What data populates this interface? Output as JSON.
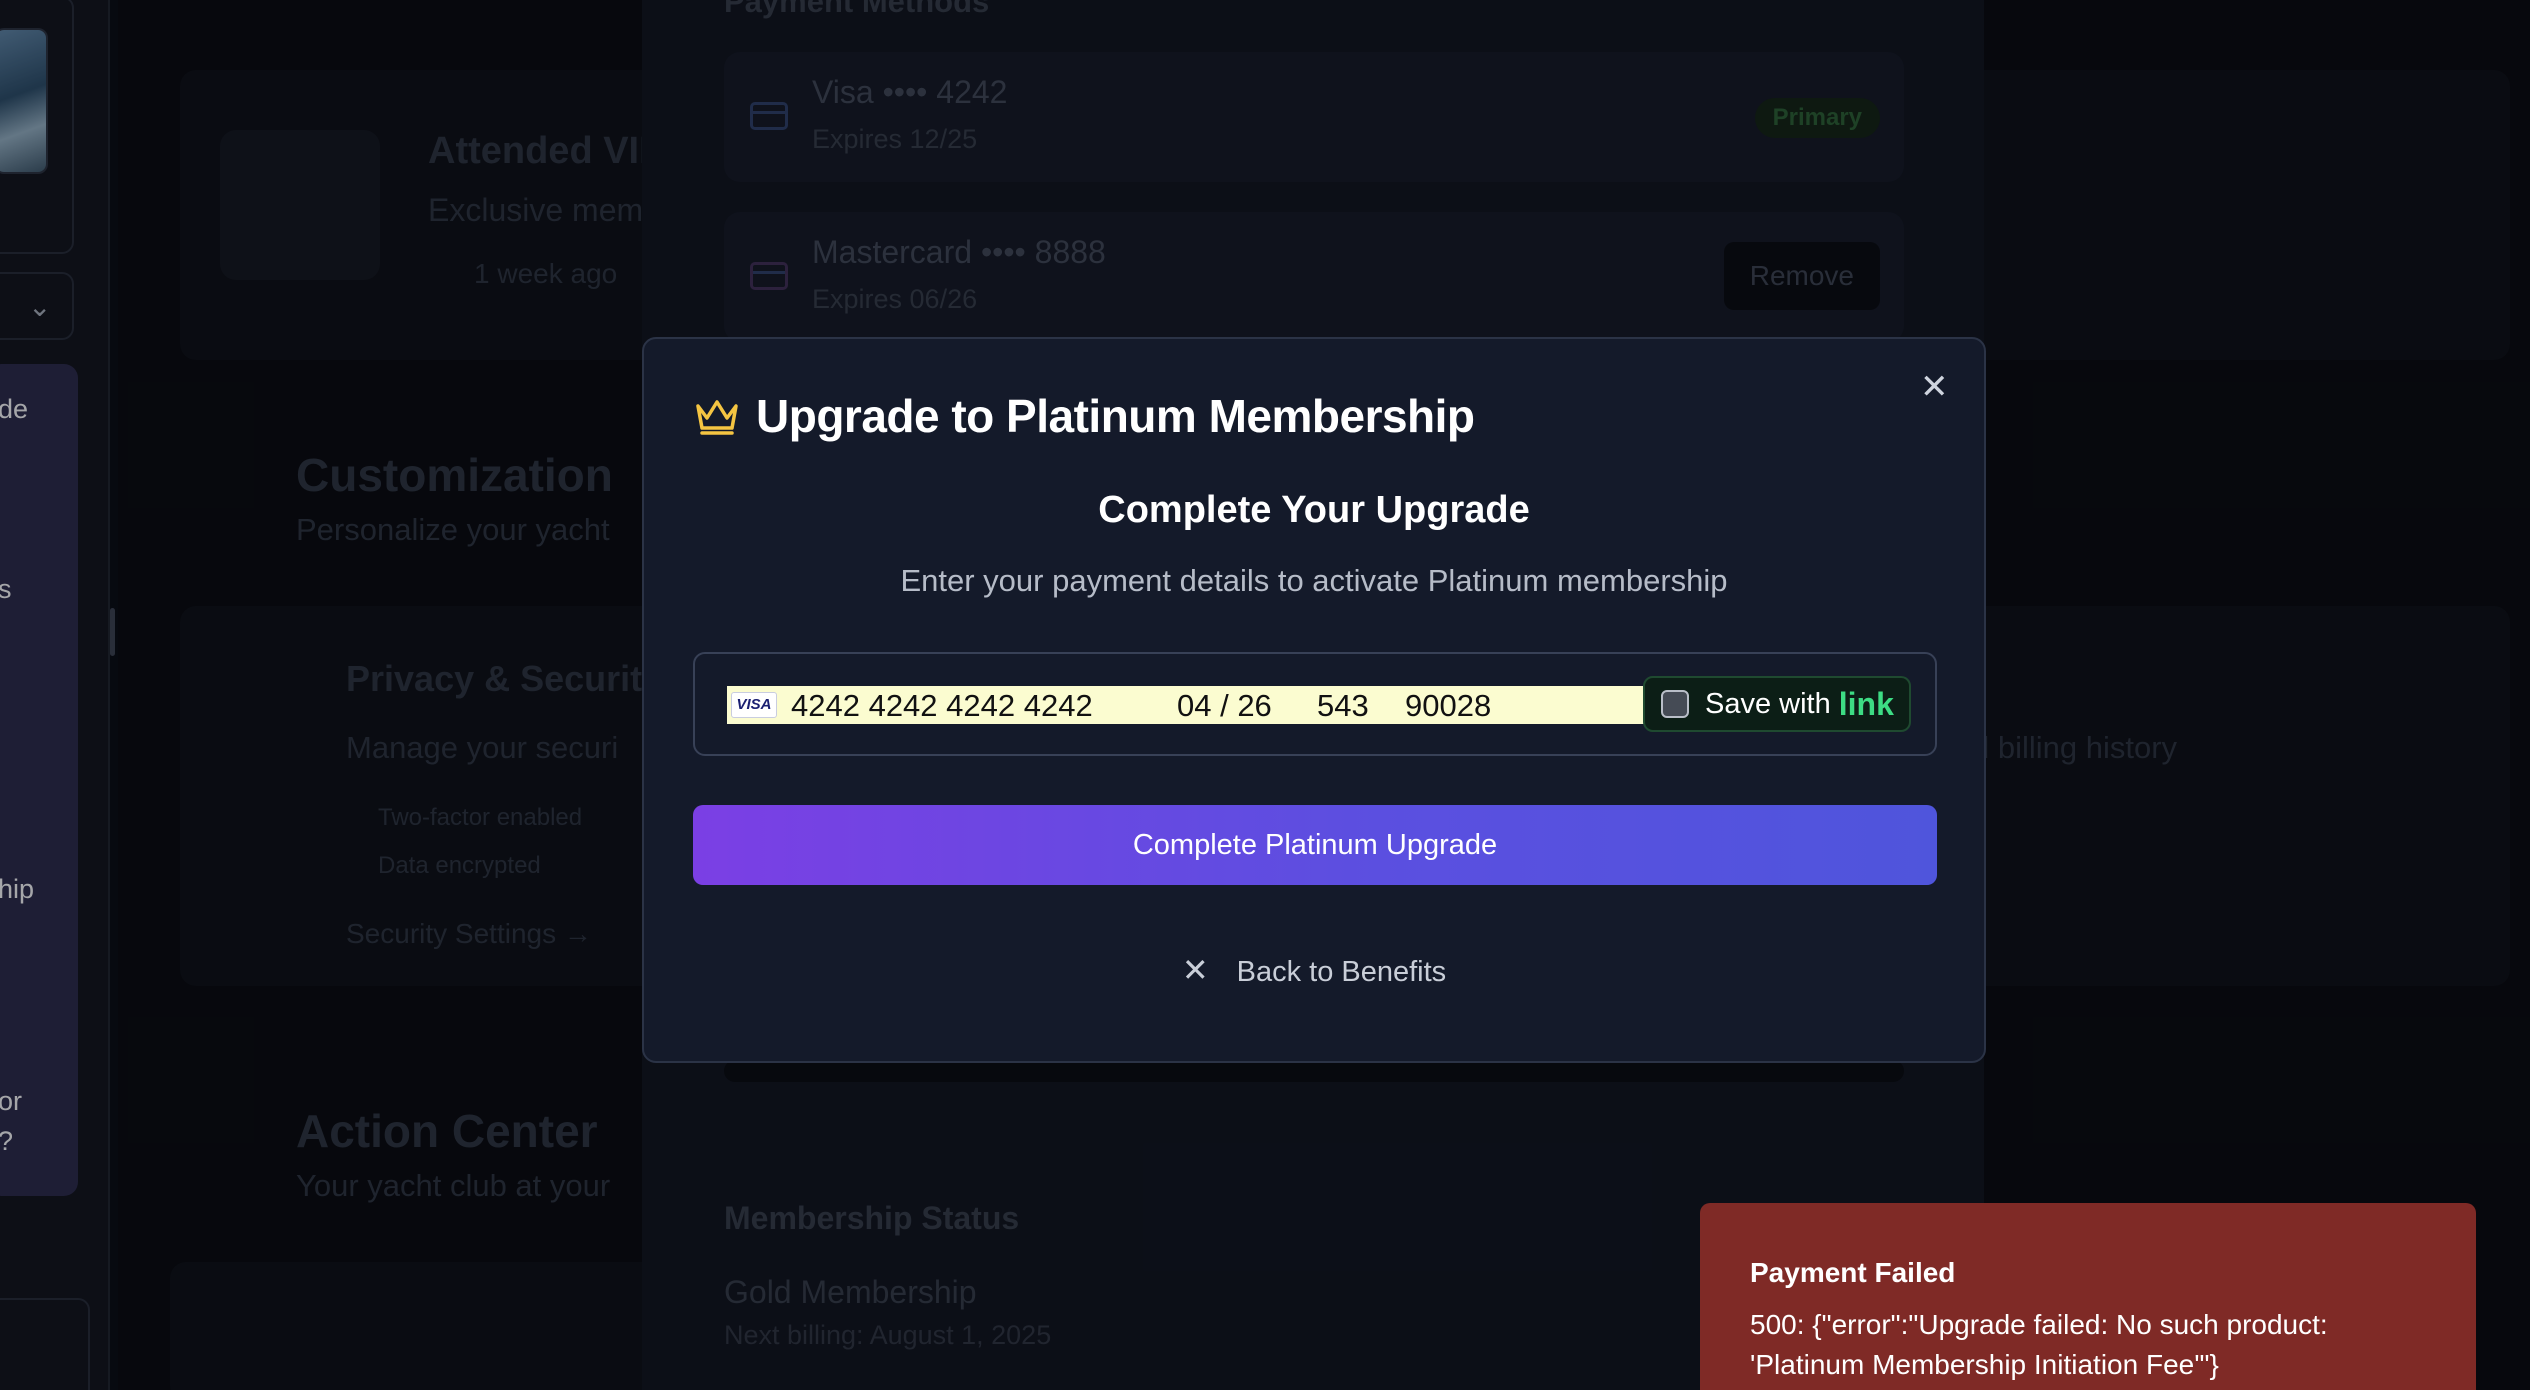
{
  "sidebar": {
    "partial_labels": [
      "de",
      "s",
      "hip",
      "or",
      "?"
    ]
  },
  "background": {
    "payment_methods_title": "Payment Methods",
    "cards": [
      {
        "name": "Visa •••• 4242",
        "expires": "Expires 12/25",
        "badge": "Primary"
      },
      {
        "name": "Mastercard •••• 8888",
        "expires": "Expires 06/26",
        "action": "Remove"
      }
    ],
    "activity": {
      "title": "Attended VIP",
      "subtitle": "Exclusive mem",
      "time": "1 week ago"
    },
    "customization": {
      "title": "Customization",
      "subtitle": "Personalize your yacht"
    },
    "privacy": {
      "title": "Privacy & Securit",
      "subtitle": "Manage your securi",
      "items": [
        "Two-factor enabled",
        "Data encrypted"
      ],
      "link": "Security Settings →"
    },
    "billing_fragment": "d billing history",
    "action_center": {
      "title": "Action Center",
      "subtitle": "Your yacht club at your"
    },
    "membership": {
      "title": "Membership Status",
      "plan": "Gold Membership",
      "next_billing": "Next billing: August 1, 2025"
    }
  },
  "modal": {
    "title": "Upgrade to Platinum Membership",
    "subtitle": "Complete Your Upgrade",
    "description": "Enter your payment details to activate Platinum membership",
    "card_brand": "VISA",
    "card_number": "4242 4242 4242 4242",
    "card_expiry": "04 / 26",
    "card_cvc": "543",
    "card_zip": "90028",
    "save_with_label": "Save with",
    "save_with_brand": "link",
    "primary_button": "Complete Platinum Upgrade",
    "back_button": "Back to Benefits"
  },
  "toast": {
    "title": "Payment Failed",
    "message": "500: {\"error\":\"Upgrade failed: No such product: 'Platinum Membership Initiation Fee'\"}"
  },
  "colors": {
    "accent_gradient_start": "#7b3fe4",
    "accent_gradient_end": "#4f55dc",
    "crown": "#f5c542",
    "link_green": "#3ddc84",
    "toast_error": "#7f2a26"
  }
}
